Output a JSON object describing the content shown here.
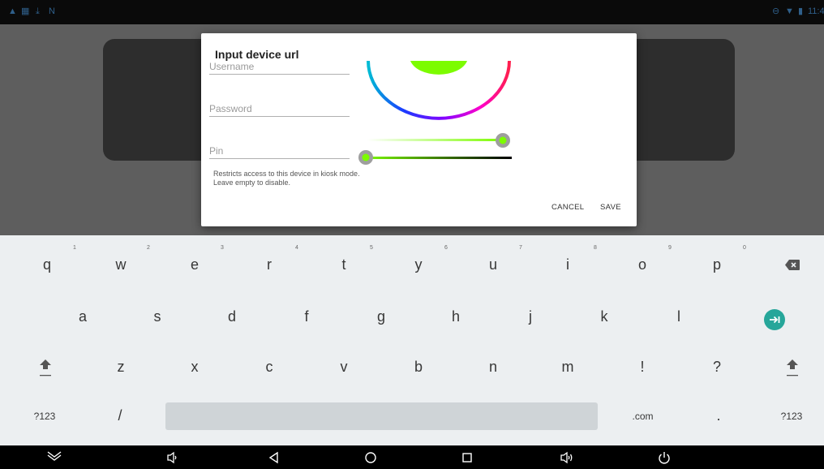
{
  "status_bar": {
    "left_icons": [
      "warning-icon",
      "calendar-icon",
      "download-icon",
      "n-icon"
    ],
    "right_icons": [
      "minus-circle-icon",
      "wifi-icon",
      "battery-icon"
    ],
    "time": "11:4"
  },
  "dialog": {
    "title": "Input device url",
    "username_placeholder": "Username",
    "password_placeholder": "Password",
    "pin_placeholder": "Pin",
    "hint": "Restricts access to this device in kiosk mode. Leave empty to disable.",
    "cancel_label": "CANCEL",
    "save_label": "SAVE",
    "colors": {
      "selected_hue": "#7cfc00",
      "accent": "#8bc34a"
    }
  },
  "keyboard": {
    "row1": [
      {
        "key": "q",
        "num": "1"
      },
      {
        "key": "w",
        "num": "2"
      },
      {
        "key": "e",
        "num": "3"
      },
      {
        "key": "r",
        "num": "4"
      },
      {
        "key": "t",
        "num": "5"
      },
      {
        "key": "y",
        "num": "6"
      },
      {
        "key": "u",
        "num": "7"
      },
      {
        "key": "i",
        "num": "8"
      },
      {
        "key": "o",
        "num": "9"
      },
      {
        "key": "p",
        "num": "0"
      }
    ],
    "row2": [
      "a",
      "s",
      "d",
      "f",
      "g",
      "h",
      "j",
      "k",
      "l"
    ],
    "row3": [
      "z",
      "x",
      "c",
      "v",
      "b",
      "n",
      "m",
      "!",
      "?"
    ],
    "symbols_label": "?123",
    "slash_label": "/",
    "dotcom_label": ".com",
    "period_label": ".",
    "symbols_label_right": "?123",
    "enter_color": "#26a69a"
  },
  "nav_bar": {
    "icons": [
      "hide-keyboard-icon",
      "volume-down-icon",
      "back-icon",
      "home-icon",
      "recents-icon",
      "volume-up-icon",
      "power-icon"
    ]
  }
}
